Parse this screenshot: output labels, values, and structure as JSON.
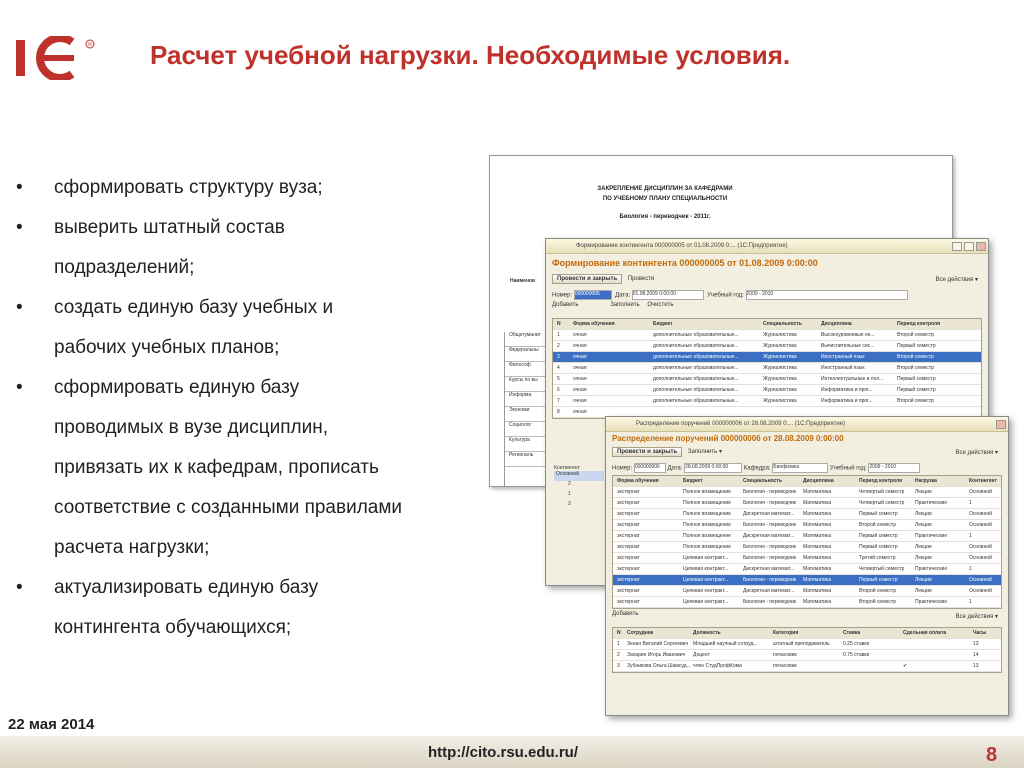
{
  "logo": {
    "text": "1С"
  },
  "title": "Расчет учебной нагрузки. Необходимые условия.",
  "bullets": [
    {
      "marker": "•",
      "lines": [
        "сформировать структуру вуза;"
      ]
    },
    {
      "marker": "•",
      "lines": [
        "выверить штатный состав",
        "подразделений;"
      ]
    },
    {
      "marker": "•",
      "lines": [
        "создать единую базу учебных и",
        "рабочих учебных планов;"
      ]
    },
    {
      "marker": "•",
      "lines": [
        "сформировать единую базу",
        "проводимых в вузе дисциплин,",
        "привязать их к кафедрам, прописать",
        "соответствие с созданными правилами",
        "расчета нагрузки;"
      ]
    },
    {
      "marker": "•",
      "lines": [
        "актуализировать единую базу",
        "контингента обучающихся;"
      ]
    }
  ],
  "date": "22 мая 2014",
  "url": "http://cito.rsu.edu.ru/",
  "page_number": "8",
  "colors": {
    "title": "#c0312b",
    "accent": "#c06a0b",
    "selection": "#3b6fc4"
  },
  "doc_screenshot": {
    "title1": "ЗАКРЕПЛЕНИЕ ДИСЦИПЛИН ЗА КАФЕДРАМИ",
    "title2": "ПО УЧЕБНОМУ ПЛАНУ СПЕЦИАЛЬНОСТИ",
    "subtitle": "Биология - переводчик - 2011г.",
    "side_label": "Наименов",
    "rows": [
      "Общегуманит",
      "Федеральны",
      "Философ",
      "Курсы по вы",
      "Информа",
      "Экономи",
      "Социолог",
      "Культура",
      "Региональ"
    ]
  },
  "window1": {
    "title": "Формирование контингента 000000005 от 01.08.2009 0:... (1С:Предприятие)",
    "heading": "Формирование контингента 000000005 от 01.08.2009 0:00:00",
    "btn_post": "Провести и закрыть",
    "btn_post2": "Провести",
    "all_actions": "Все действия ▾",
    "label_number": "Номер:",
    "number": "000000005",
    "label_date": "Дата:",
    "date": "01.08.2009  0:00:00",
    "label_year": "Учебный год:",
    "year": "2009 - 2010",
    "btn_add": "Добавить",
    "btn_fill": "Заполнить",
    "btn_clear": "Очистить",
    "columns": [
      "N",
      "Форма обучения",
      "Бюджет",
      "Специальность",
      "Дисциплина",
      "Период контроля"
    ],
    "rows": [
      [
        "1",
        "очная",
        "дополнительные образовательные...",
        "Журналистика",
        "Высокоуровневые не...",
        "Второй семестр"
      ],
      [
        "2",
        "очная",
        "дополнительные образовательные...",
        "Журналистика",
        "Вычислительные сис...",
        "Первый семестр"
      ],
      [
        "3",
        "очная",
        "дополнительные образовательные...",
        "Журналистика",
        "Иностранный язык",
        "Второй семестр"
      ],
      [
        "4",
        "очная",
        "дополнительные образовательные...",
        "Журналистика",
        "Иностранный язык",
        "Второй семестр"
      ],
      [
        "5",
        "очная",
        "дополнительные образовательные...",
        "Журналистика",
        "Интеллектуальные и пол...",
        "Первый семестр"
      ],
      [
        "6",
        "очная",
        "дополнительные образовательные...",
        "Журналистика",
        "Информатика и прог...",
        "Первый семестр"
      ],
      [
        "7",
        "очная",
        "дополнительные образовательные...",
        "Журналистика",
        "Информатика и прог...",
        "Второй семестр"
      ],
      [
        "8",
        "очная",
        "",
        "",
        "",
        ""
      ]
    ],
    "selected_row": 2,
    "tree_label": "Контингент",
    "tree_items": [
      "Основной",
      "2",
      "1",
      "2"
    ]
  },
  "window2": {
    "title": "Распределение поручений 000000006 от 28.08.2009 0:... (1С:Предприятие)",
    "heading": "Распределение поручений 000000006 от 28.08.2009 0:00:00",
    "btn_post": "Провести и закрыть",
    "btn_fill": "Заполнить ▾",
    "all_actions": "Все действия ▾",
    "label_number": "Номер:",
    "number": "000000006",
    "label_date": "Дата:",
    "date": "28.08.2009  0:00:00",
    "label_dept": "Кафедра:",
    "dept": "Биофизика",
    "label_year": "Учебный год:",
    "year": "2009 - 2010",
    "columns": [
      "Форма обучения",
      "Бюджет",
      "Специальность",
      "Дисциплина",
      "Период контроля",
      "Нагрузка",
      "Контингент"
    ],
    "rows": [
      [
        "экстернат",
        "Полное возмещение",
        "Биология - переводчик",
        "Математика",
        "Четвертый семестр",
        "Лекции",
        "Основной"
      ],
      [
        "экстернат",
        "Полное возмещение",
        "Биология - переводчик",
        "Математика",
        "Четвертый семестр",
        "Практические",
        "1"
      ],
      [
        "экстернат",
        "Полное возмещение",
        "Дискретная математ...",
        "Математика",
        "Первый семестр",
        "Лекции",
        "Основной"
      ],
      [
        "экстернат",
        "Полное возмещение",
        "Биология - переводчик",
        "Математика",
        "Второй семестр",
        "Лекции",
        "Основной"
      ],
      [
        "экстернат",
        "Полное возмещение",
        "Дискретная математ...",
        "Математика",
        "Первый семестр",
        "Практические",
        "1"
      ],
      [
        "экстернат",
        "Полное возмещение",
        "Биология - переводчик",
        "Математика",
        "Первый семестр",
        "Лекции",
        "Основной"
      ],
      [
        "экстернат",
        "Целевая контракт...",
        "Биология - переводчик",
        "Математика",
        "Третий семестр",
        "Лекции",
        "Основной"
      ],
      [
        "экстернат",
        "Целевая контракт...",
        "Дискретная математ...",
        "Математика",
        "Четвертый семестр",
        "Практические",
        "1"
      ],
      [
        "экстернат",
        "Целевая контракт...",
        "Биология - переводчик",
        "Математика",
        "Первый семестр",
        "Лекции",
        "Основной"
      ],
      [
        "экстернат",
        "Целевая контракт...",
        "Дискретная математ...",
        "Математика",
        "Второй семестр",
        "Лекции",
        "Основной"
      ],
      [
        "экстернат",
        "Целевая контракт...",
        "Биология - переводчик",
        "Математика",
        "Второй семестр",
        "Практические",
        "1"
      ]
    ],
    "selected_row": 8,
    "btn_add": "Добавить",
    "sub_columns": [
      "N",
      "Сотрудник",
      "Должность",
      "Категория",
      "Ставка",
      "Сдельная оплата",
      "Часы"
    ],
    "sub_rows": [
      [
        "1",
        "Зенин Виталий Сергеевич",
        "Младший научный сотруд...",
        "штатный преподаватель",
        "0.25 ставки",
        "",
        "13"
      ],
      [
        "2",
        "Захарин Игорь Иванович",
        "Доцент",
        "почасовик",
        "0.75 ставки",
        "",
        "14"
      ],
      [
        "3",
        "Зубникова Ольга Шамсуд...",
        "член СтудПрофКома",
        "почасовик",
        "",
        "✔",
        "13"
      ]
    ]
  }
}
